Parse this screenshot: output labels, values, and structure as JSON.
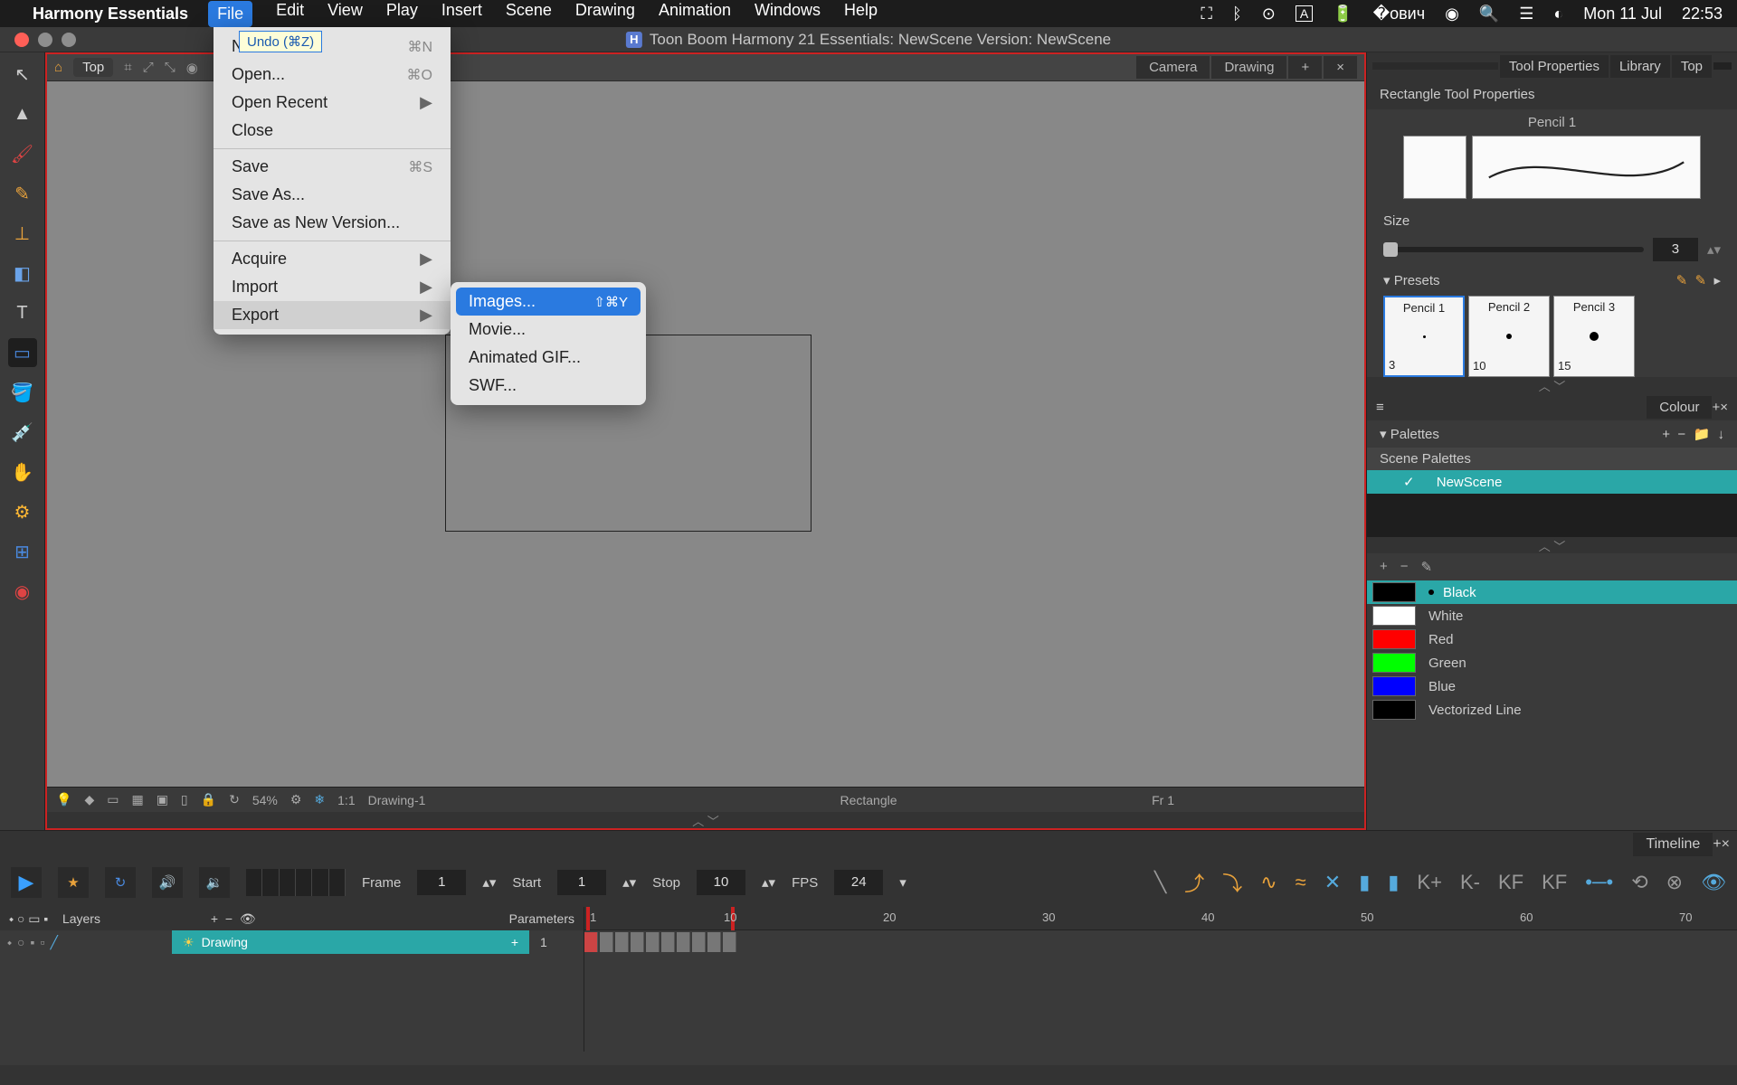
{
  "mac": {
    "app_name": "Harmony Essentials",
    "menus": [
      "File",
      "Edit",
      "View",
      "Play",
      "Insert",
      "Scene",
      "Drawing",
      "Animation",
      "Windows",
      "Help"
    ],
    "active_menu": "File",
    "date": "Mon 11 Jul",
    "time": "22:53"
  },
  "window": {
    "title": "Toon Boom Harmony 21 Essentials: NewScene Version: NewScene"
  },
  "undo_tip": "Undo (⌘Z)",
  "file_menu": {
    "new_partial": "N",
    "new_sc": "⌘N",
    "open": "Open...",
    "open_sc": "⌘O",
    "open_recent": "Open Recent",
    "close": "Close",
    "save": "Save",
    "save_sc": "⌘S",
    "save_as": "Save As...",
    "save_version": "Save as New Version...",
    "acquire": "Acquire",
    "import": "Import",
    "export": "Export"
  },
  "export_sub": {
    "images": "Images...",
    "images_sc": "⇧⌘Y",
    "movie": "Movie...",
    "gif": "Animated GIF...",
    "swf": "SWF..."
  },
  "viewport": {
    "top_label": "Top",
    "tabs": {
      "camera": "Camera",
      "drawing": "Drawing"
    },
    "status": {
      "zoom": "54%",
      "ratio": "1:1",
      "drawing": "Drawing-1",
      "tool": "Rectangle",
      "frame": "Fr 1"
    }
  },
  "right": {
    "tabs": {
      "tool": "Tool Properties",
      "library": "Library",
      "top": "Top"
    },
    "tool_props_title": "Rectangle Tool Properties",
    "pencil_lbl": "Pencil 1",
    "size_lbl": "Size",
    "size_val": "3",
    "presets_lbl": "Presets",
    "presets": [
      {
        "name": "Pencil 1",
        "size": "3"
      },
      {
        "name": "Pencil 2",
        "size": "10"
      },
      {
        "name": "Pencil 3",
        "size": "15"
      }
    ],
    "colour_tab": "Colour",
    "palettes_lbl": "Palettes",
    "scene_palettes": "Scene Palettes",
    "palette_name": "NewScene",
    "swatches": [
      {
        "name": "Black",
        "hex": "#000000"
      },
      {
        "name": "White",
        "hex": "#ffffff"
      },
      {
        "name": "Red",
        "hex": "#ff0000"
      },
      {
        "name": "Green",
        "hex": "#00ff00"
      },
      {
        "name": "Blue",
        "hex": "#0000ff"
      },
      {
        "name": "Vectorized Line",
        "hex": "#000000"
      }
    ]
  },
  "timeline": {
    "tab": "Timeline",
    "frame_lbl": "Frame",
    "frame_val": "1",
    "start_lbl": "Start",
    "start_val": "1",
    "stop_lbl": "Stop",
    "stop_val": "10",
    "fps_lbl": "FPS",
    "fps_val": "24",
    "layers_lbl": "Layers",
    "params_lbl": "Parameters",
    "layer_name": "Drawing",
    "layer_frame": "1",
    "ruler_marks": [
      "1",
      "10",
      "20",
      "30",
      "40",
      "50",
      "60",
      "70"
    ]
  }
}
